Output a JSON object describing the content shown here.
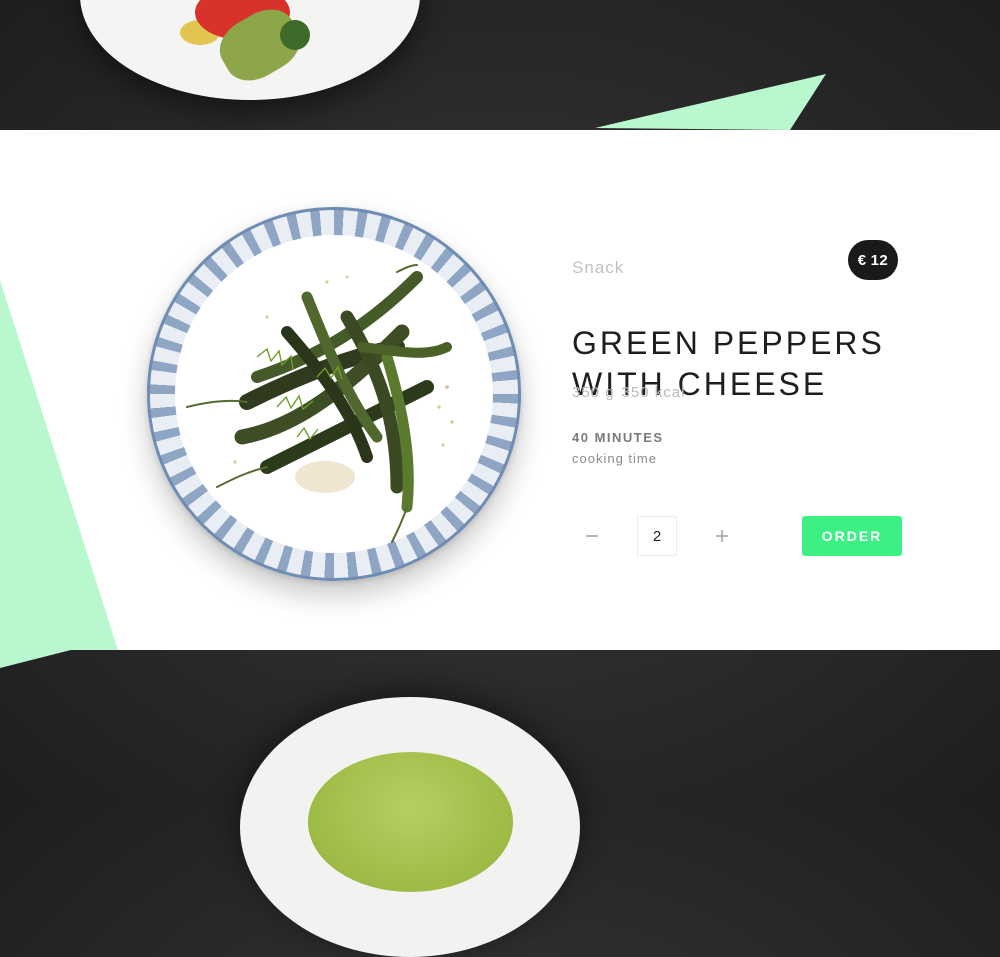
{
  "colors": {
    "accent_mint": "#b9f7cf",
    "order_button": "#3df084",
    "price_badge": "#1a1a1a",
    "background": "#2a2a2a"
  },
  "product": {
    "category": "Snack",
    "price_currency": "€",
    "price_value": "12",
    "title_line1": "GREEN PEPPERS",
    "title_line2": "WITH CHEESE",
    "weight": "350 g",
    "calories": "350 kcal",
    "cooking_time_value": "40 MINUTES",
    "cooking_time_label": "cooking time"
  },
  "order": {
    "minus_icon": "minus-icon",
    "plus_icon": "plus-icon",
    "quantity": "2",
    "button_label": "ORDER"
  }
}
